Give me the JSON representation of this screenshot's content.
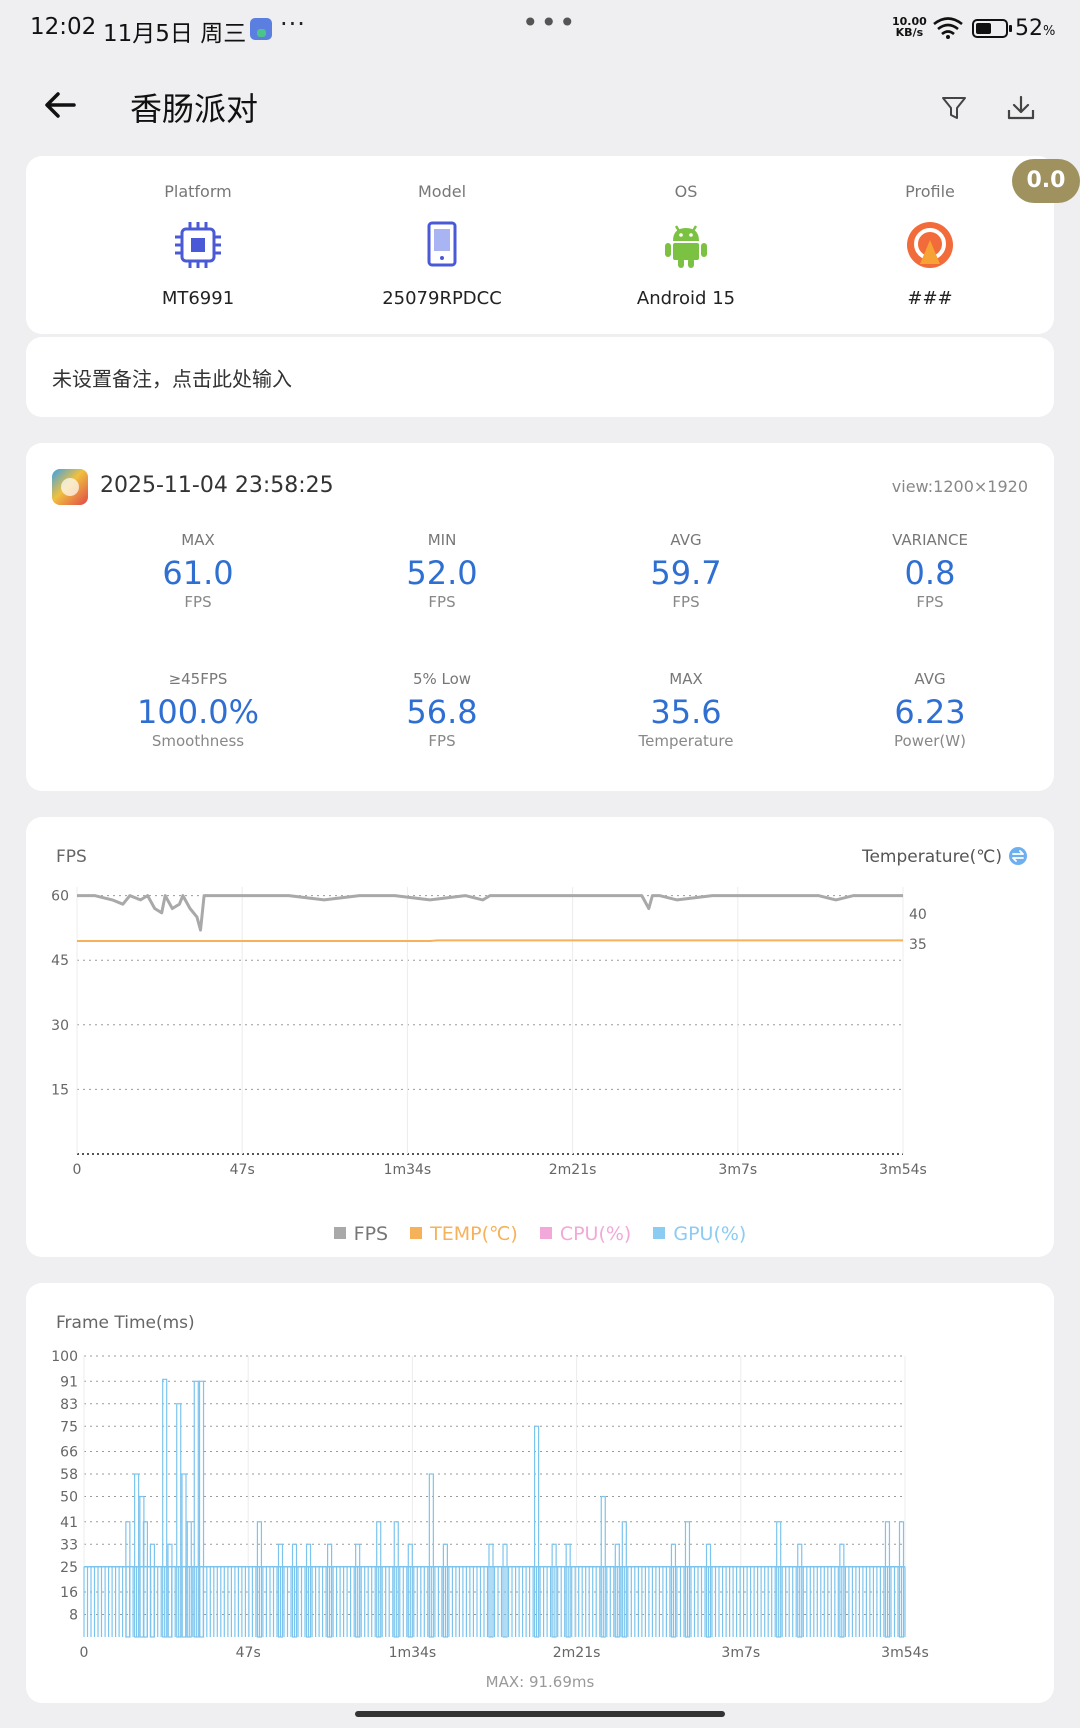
{
  "status_bar": {
    "time": "12:02",
    "date": "11月5日 周三",
    "more_dots": "···",
    "center_dots": "•••",
    "net_speed_value": "10.00",
    "net_speed_unit": "KB/s",
    "battery_level": 0.52,
    "battery_pct": "52",
    "battery_pct_sign": "%"
  },
  "header": {
    "title": "香肠派对",
    "icons": [
      "back-arrow-icon",
      "filter-icon",
      "download-icon"
    ]
  },
  "badge": "0.0",
  "device": [
    {
      "label": "Platform",
      "value": "MT6991",
      "icon": "chip-icon"
    },
    {
      "label": "Model",
      "value": "25079RPDCC",
      "icon": "phone-icon"
    },
    {
      "label": "OS",
      "value": "Android 15",
      "icon": "android-icon"
    },
    {
      "label": "Profile",
      "value": "###",
      "icon": "profile-icon"
    }
  ],
  "note": {
    "placeholder": "未设置备注，点击此处输入"
  },
  "session": {
    "timestamp": "2025-11-04 23:58:25",
    "view": "view:1200×1920",
    "stats": [
      {
        "top": "MAX",
        "value": "61.0",
        "unit": "FPS"
      },
      {
        "top": "MIN",
        "value": "52.0",
        "unit": "FPS"
      },
      {
        "top": "AVG",
        "value": "59.7",
        "unit": "FPS"
      },
      {
        "top": "VARIANCE",
        "value": "0.8",
        "unit": "FPS"
      },
      {
        "top": "≥45FPS",
        "value": "100.0%",
        "unit": "Smoothness"
      },
      {
        "top": "5% Low",
        "value": "56.8",
        "unit": "FPS"
      },
      {
        "top": "MAX",
        "value": "35.6",
        "unit": "Temperature"
      },
      {
        "top": "AVG",
        "value": "6.23",
        "unit": "Power(W)"
      }
    ]
  },
  "colors": {
    "accent_blue": "#2f6fd1",
    "fps_line": "#a9a9a9",
    "temp_line": "#f5b25a",
    "cpu": "#f2a8d8",
    "gpu": "#8ccbf2",
    "frame_bar": "#7cc4ee",
    "badge": "#9f925e",
    "profile_orange": "#f26b3a",
    "android_green": "#7cc242",
    "chip_blue": "#4a5ad6"
  },
  "chart_data": [
    {
      "type": "line",
      "title": "FPS",
      "ylabel_right": "Temperature(℃)",
      "x_ticks": [
        "0",
        "47s",
        "1m34s",
        "2m21s",
        "3m7s",
        "3m54s"
      ],
      "x_range_s": [
        0,
        234
      ],
      "y_ticks": [
        60,
        45,
        30,
        15
      ],
      "y_range": [
        0,
        62
      ],
      "y_right_ticks": [
        40,
        35
      ],
      "y_right_range": [
        0,
        44.5
      ],
      "grid": true,
      "legend_position": "bottom-center",
      "legend": [
        {
          "name": "FPS",
          "color": "#a9a9a9"
        },
        {
          "name": "TEMP(℃)",
          "color": "#f5b25a"
        },
        {
          "name": "CPU(%)",
          "color": "#f2a8d8"
        },
        {
          "name": "GPU(%)",
          "color": "#8ccbf2"
        }
      ],
      "series": [
        {
          "name": "FPS",
          "x": [
            0,
            5,
            10,
            13,
            15,
            18,
            20,
            22,
            24,
            25,
            27,
            29,
            30,
            32,
            34,
            35,
            36,
            40,
            50,
            60,
            70,
            80,
            90,
            100,
            110,
            115,
            117,
            120,
            130,
            140,
            150,
            160,
            162,
            163,
            165,
            170,
            180,
            190,
            200,
            210,
            215,
            220,
            230,
            234
          ],
          "values": [
            60,
            60,
            59,
            58,
            60,
            59,
            60,
            57,
            56,
            60,
            57,
            58,
            60,
            57,
            55,
            52,
            60,
            60,
            60,
            60,
            59,
            60,
            60,
            59,
            60,
            59,
            60,
            60,
            60,
            60,
            60,
            60,
            57,
            60,
            60,
            59,
            60,
            60,
            60,
            60,
            59,
            60,
            60,
            60
          ]
        },
        {
          "name": "TEMP(℃)",
          "x": [
            0,
            100,
            102,
            234
          ],
          "values": [
            35.5,
            35.5,
            35.6,
            35.6
          ]
        }
      ]
    },
    {
      "type": "bar",
      "title": "Frame Time(ms)",
      "x_ticks": [
        "0",
        "47s",
        "1m34s",
        "2m21s",
        "3m7s",
        "3m54s"
      ],
      "x_range_s": [
        0,
        234
      ],
      "y_ticks": [
        100,
        91,
        83,
        75,
        66,
        58,
        50,
        41,
        33,
        25,
        16,
        8
      ],
      "y_range": [
        0,
        100
      ],
      "baseline_ms": 25,
      "spikes": [
        {
          "t": 12.5,
          "ms": 41
        },
        {
          "t": 15.0,
          "ms": 58
        },
        {
          "t": 16.5,
          "ms": 50
        },
        {
          "t": 17.5,
          "ms": 41
        },
        {
          "t": 19.5,
          "ms": 33
        },
        {
          "t": 23.0,
          "ms": 91.69
        },
        {
          "t": 24.5,
          "ms": 33
        },
        {
          "t": 27.0,
          "ms": 83
        },
        {
          "t": 28.5,
          "ms": 58
        },
        {
          "t": 30.0,
          "ms": 41
        },
        {
          "t": 32.0,
          "ms": 91
        },
        {
          "t": 33.5,
          "ms": 91
        },
        {
          "t": 50.0,
          "ms": 41
        },
        {
          "t": 56.0,
          "ms": 33
        },
        {
          "t": 60.0,
          "ms": 33
        },
        {
          "t": 64.0,
          "ms": 33
        },
        {
          "t": 70.0,
          "ms": 33
        },
        {
          "t": 78.0,
          "ms": 33
        },
        {
          "t": 84.0,
          "ms": 41
        },
        {
          "t": 89.0,
          "ms": 41
        },
        {
          "t": 93.0,
          "ms": 33
        },
        {
          "t": 99.0,
          "ms": 58
        },
        {
          "t": 103.0,
          "ms": 33
        },
        {
          "t": 116.0,
          "ms": 33
        },
        {
          "t": 120.0,
          "ms": 33
        },
        {
          "t": 129.0,
          "ms": 75
        },
        {
          "t": 134.0,
          "ms": 33
        },
        {
          "t": 138.0,
          "ms": 33
        },
        {
          "t": 148.0,
          "ms": 50
        },
        {
          "t": 152.0,
          "ms": 33
        },
        {
          "t": 154.0,
          "ms": 41
        },
        {
          "t": 168.0,
          "ms": 33
        },
        {
          "t": 172.0,
          "ms": 41
        },
        {
          "t": 178.0,
          "ms": 33
        },
        {
          "t": 198.0,
          "ms": 41
        },
        {
          "t": 204.0,
          "ms": 33
        },
        {
          "t": 216.0,
          "ms": 33
        },
        {
          "t": 229.0,
          "ms": 41
        },
        {
          "t": 233.0,
          "ms": 41
        }
      ],
      "max_label": "MAX: 91.69ms"
    }
  ]
}
